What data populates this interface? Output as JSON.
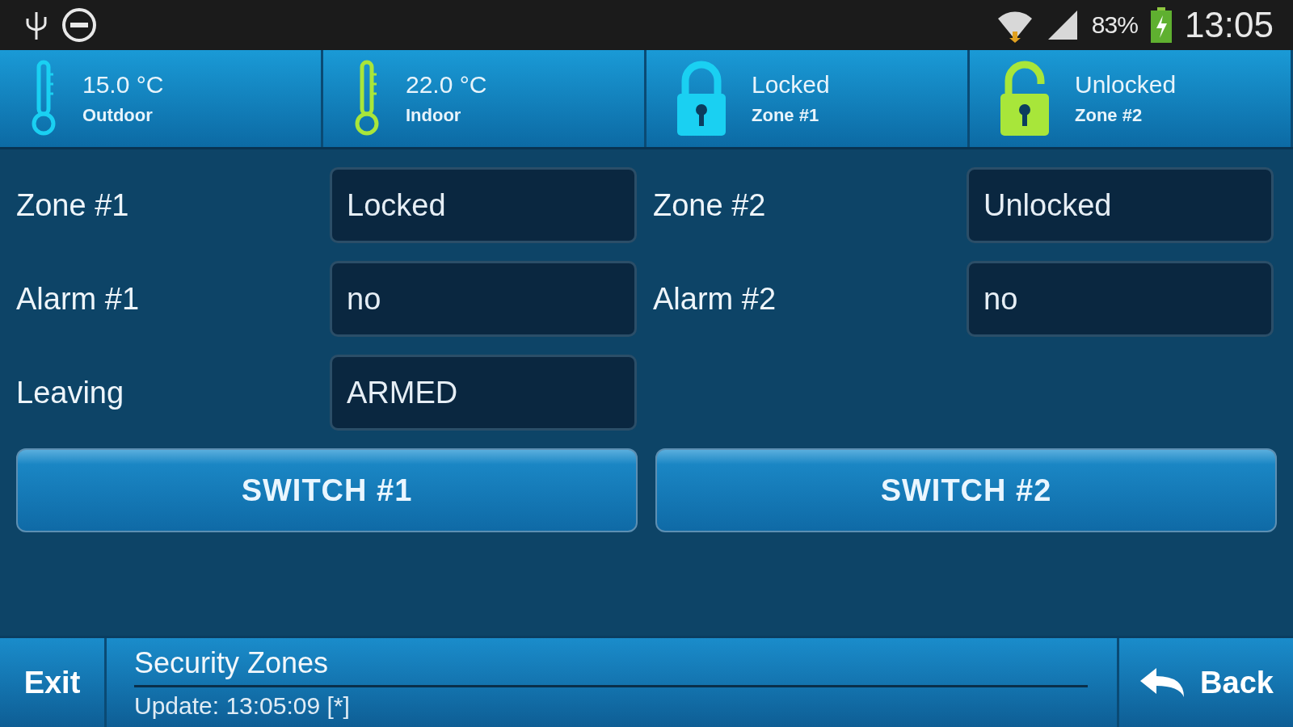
{
  "status_bar": {
    "battery_text": "83%",
    "time": "13:05"
  },
  "tiles": [
    {
      "kind": "thermometer",
      "value": "15.0 °C",
      "label": "Outdoor",
      "color": "#1ad0f2"
    },
    {
      "kind": "thermometer",
      "value": "22.0 °C",
      "label": "Indoor",
      "color": "#a8e63a"
    },
    {
      "kind": "lock",
      "locked": true,
      "value": "Locked",
      "label": "Zone #1",
      "color": "#1ad0f2"
    },
    {
      "kind": "lock",
      "locked": false,
      "value": "Unlocked",
      "label": "Zone #2",
      "color": "#a8e63a"
    }
  ],
  "left": [
    {
      "label": "Zone #1",
      "value": "Locked"
    },
    {
      "label": "Alarm #1",
      "value": "no"
    },
    {
      "label": "Leaving",
      "value": "ARMED"
    }
  ],
  "right": [
    {
      "label": "Zone #2",
      "value": "Unlocked"
    },
    {
      "label": "Alarm #2",
      "value": "no"
    }
  ],
  "buttons": [
    "SWITCH #1",
    "SWITCH #2"
  ],
  "footer": {
    "exit": "Exit",
    "title": "Security Zones",
    "update": "Update: 13:05:09 [*]",
    "back": "Back"
  }
}
